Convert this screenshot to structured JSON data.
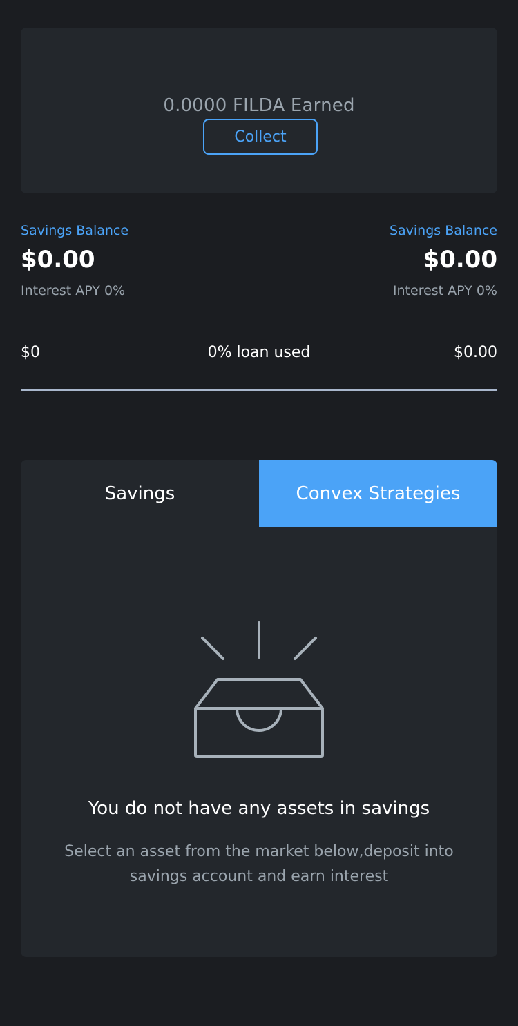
{
  "earned": {
    "text": "0.0000 FILDA Earned",
    "collect_label": "Collect"
  },
  "balances": {
    "left": {
      "label": "Savings Balance",
      "value": "$0.00",
      "apy": "Interest APY 0%"
    },
    "right": {
      "label": "Savings Balance",
      "value": "$0.00",
      "apy": "Interest APY 0%"
    }
  },
  "loan": {
    "left_value": "$0",
    "used_text": "0% loan used",
    "right_value": "$0.00",
    "used_fraction": 0
  },
  "tabs": [
    {
      "label": "Savings",
      "active": false
    },
    {
      "label": "Convex Strategies",
      "active": true
    }
  ],
  "empty_state": {
    "icon": "empty-inbox-icon",
    "title": "You do not have any assets in savings",
    "description": "Select an asset from the market below,deposit into savings account and earn interest"
  },
  "colors": {
    "background": "#1b1d21",
    "card": "#23272c",
    "accent": "#4ba3f7",
    "muted_text": "#9aa4ad"
  }
}
